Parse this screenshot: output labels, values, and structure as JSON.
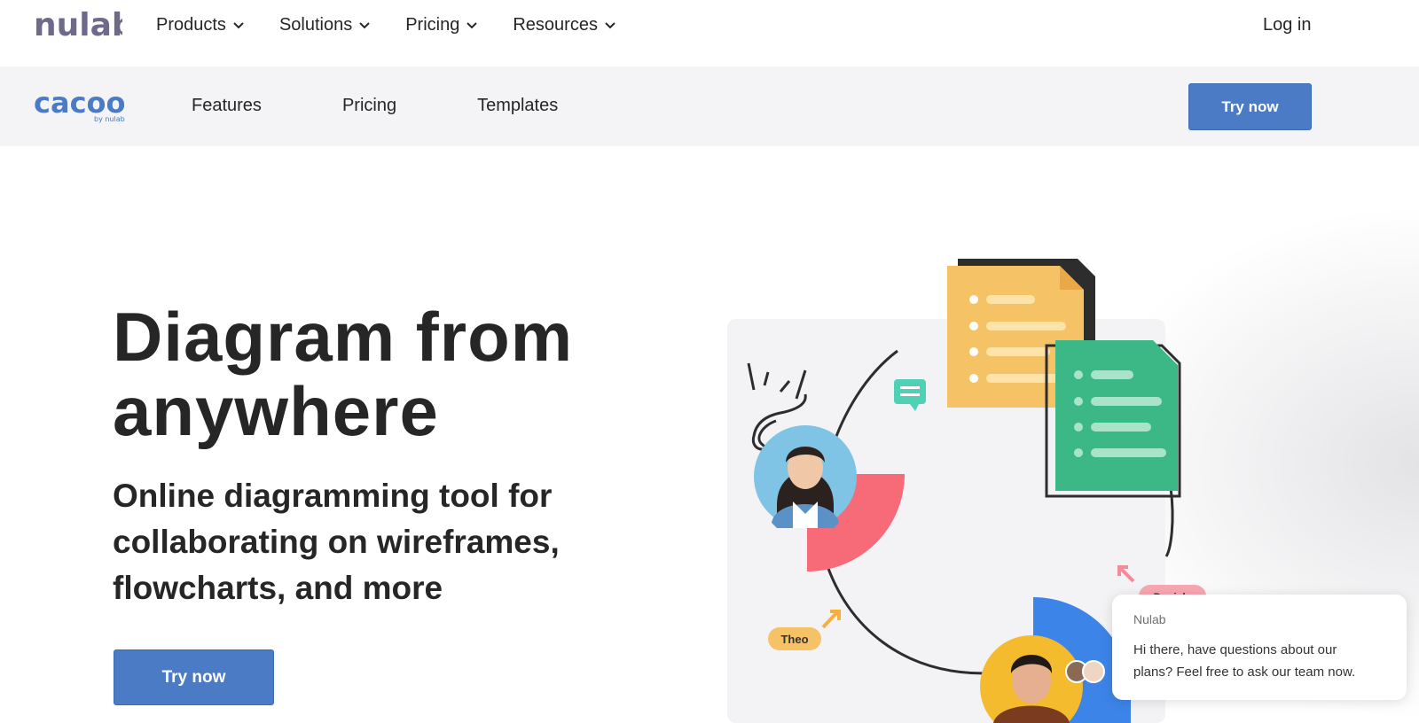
{
  "brand": {
    "company_logo_text": "nulab",
    "product_logo_text": "cacoo",
    "product_logo_tagline": "by nulab",
    "accent_color": "#4b7bc4"
  },
  "topnav": {
    "items": [
      {
        "label": "Products",
        "icon": "chevron-down-icon"
      },
      {
        "label": "Solutions",
        "icon": "chevron-down-icon"
      },
      {
        "label": "Pricing",
        "icon": "chevron-down-icon"
      },
      {
        "label": "Resources",
        "icon": "chevron-down-icon"
      }
    ],
    "login_label": "Log in"
  },
  "subnav": {
    "items": [
      {
        "label": "Features"
      },
      {
        "label": "Pricing"
      },
      {
        "label": "Templates"
      }
    ],
    "cta_label": "Try now"
  },
  "hero": {
    "title_line1": "Diagram from",
    "title_line2": "anywhere",
    "subtitle_line1": "Online diagramming tool for",
    "subtitle_line2": "collaborating on wireframes,",
    "subtitle_line3": "flowcharts, and more",
    "cta_label": "Try now"
  },
  "illustration": {
    "cursor_label_1": "Theo",
    "cursor_label_2": "Daniela"
  },
  "chat": {
    "sender": "Nulab",
    "message_line1": "Hi there, have questions about our",
    "message_line2": "plans? Feel free to ask our team now."
  }
}
